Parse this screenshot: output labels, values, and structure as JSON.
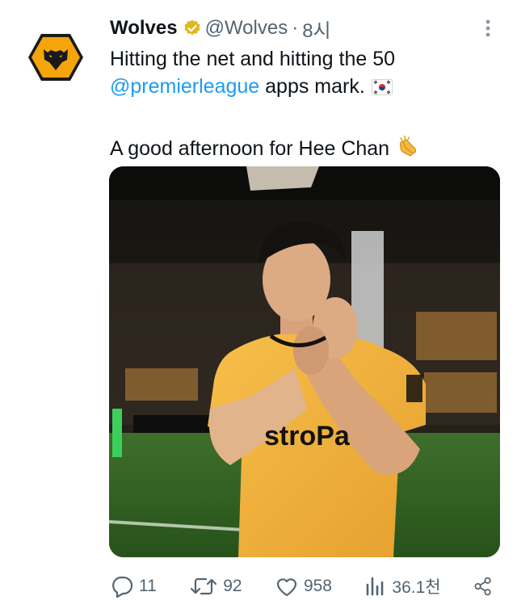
{
  "tweet": {
    "display_name": "Wolves",
    "handle": "@Wolves",
    "separator": "·",
    "time": "8시",
    "text_line1": "Hitting the net and hitting the 50",
    "mention": "@premierleague",
    "text_line2_rest": " apps mark.",
    "text_line3": "A good afternoon for Hee Chan",
    "flag_emoji": "south-korea-flag",
    "clap_emoji": "clapping-hands",
    "jersey_text": "stroPa"
  },
  "metrics": {
    "replies": "11",
    "retweets": "92",
    "likes": "958",
    "views": "36.1천"
  },
  "colors": {
    "text": "#0f1419",
    "secondary": "#536471",
    "link": "#1d9bf0",
    "verified_badge": "#e2b719",
    "wolves_gold": "#f5a50a",
    "jersey": "#f3b33c"
  },
  "icons": [
    "verified-badge-icon",
    "more-options-icon",
    "reply-icon",
    "retweet-icon",
    "like-icon",
    "views-icon",
    "share-icon"
  ]
}
